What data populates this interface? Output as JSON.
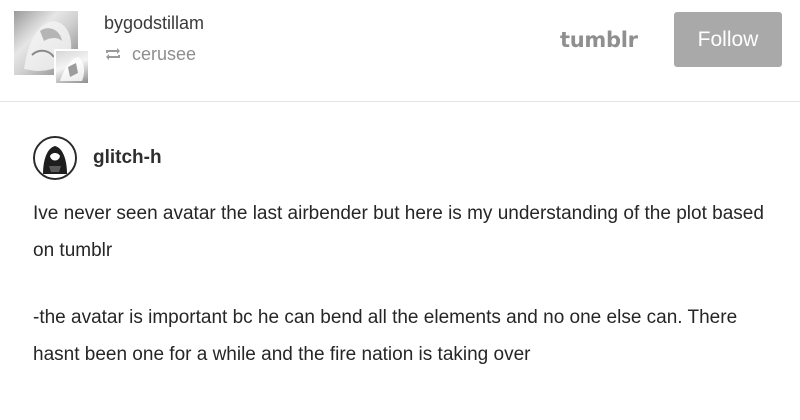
{
  "header": {
    "username": "bygodstillam",
    "reblogged_from": "cerusee",
    "reblog_icon": "reblog-icon",
    "brand": "tumblr",
    "follow_label": "Follow"
  },
  "post": {
    "author": "glitch-h",
    "paragraphs": [
      "Ive never seen avatar the last airbender but here is my understanding of the plot based on tumblr",
      "-the avatar is important bc he can bend all the elements and no one else can. There hasnt been one for a while and the fire nation is taking over"
    ]
  },
  "colors": {
    "follow_button_bg": "#a9a9a9",
    "brand_text": "#8f8f8f",
    "divider": "#e4e4e4"
  }
}
